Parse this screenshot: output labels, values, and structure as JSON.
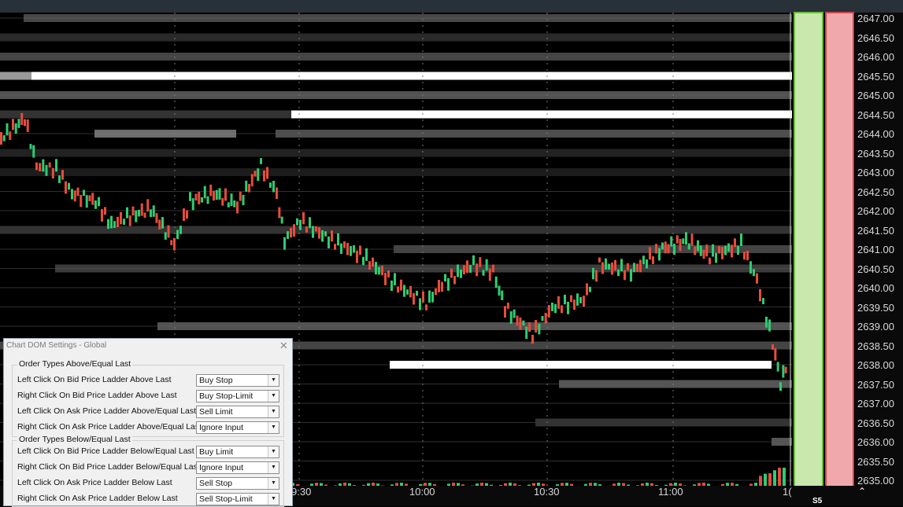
{
  "price_axis": {
    "labels": [
      "2647.00",
      "2646.50",
      "2646.00",
      "2645.50",
      "2645.00",
      "2644.50",
      "2644.00",
      "2643.50",
      "2643.00",
      "2642.50",
      "2642.00",
      "2641.50",
      "2641.00",
      "2640.50",
      "2640.00",
      "2639.50",
      "2639.00",
      "2638.50",
      "2638.00",
      "2637.50",
      "2637.00",
      "2636.50",
      "2636.00",
      "2635.50",
      "2635.00"
    ]
  },
  "time_axis": {
    "labels": [
      "9:30",
      "10:00",
      "10:30",
      "11:00",
      "1("
    ]
  },
  "bottom_status": {
    "s5": "S5"
  },
  "colors": {
    "up_bar": "#2ecc71",
    "down_bar": "#e74c3c",
    "bid_column": "#c8e8ae",
    "ask_column": "#f0a8ac"
  },
  "dialog": {
    "title": "Chart DOM Settings - Global",
    "group_above_title": "Order Types Above/Equal Last",
    "group_below_title": "Order Types Below/Equal Last",
    "rows": [
      {
        "label": "Left Click On Bid Price Ladder Above Last",
        "value": "Buy Stop"
      },
      {
        "label": "Right Click On Bid Price Ladder Above Last",
        "value": "Buy Stop-Limit"
      },
      {
        "label": "Left Click On Ask Price Ladder Above/Equal Last",
        "value": "Sell Limit"
      },
      {
        "label": "Right Click On Ask Price Ladder Above/Equal Last",
        "value": "Ignore Input"
      },
      {
        "label": "Left Click On Bid Price Ladder Below/Equal Last",
        "value": "Buy Limit"
      },
      {
        "label": "Right Click On Bid Price Ladder Below/Equal Last",
        "value": "Ignore Input"
      },
      {
        "label": "Left Click On Ask Price Ladder Below Last",
        "value": "Sell Stop"
      },
      {
        "label": "Right Click On Ask Price Ladder Below Last",
        "value": "Sell Stop-Limit"
      }
    ]
  }
}
